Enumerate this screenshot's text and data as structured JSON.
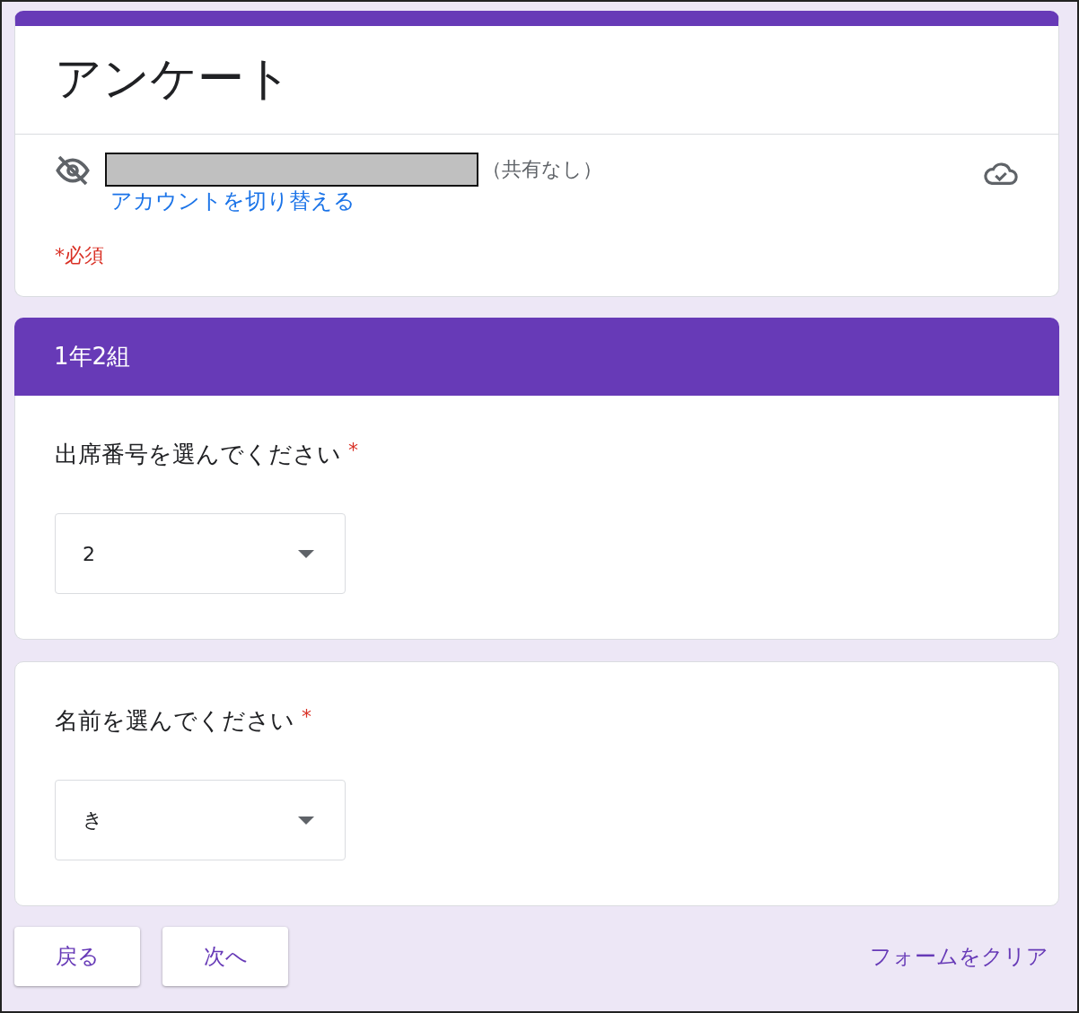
{
  "form": {
    "title": "アンケート",
    "account": {
      "sharing": "（共有なし）",
      "switch_link": "アカウントを切り替える"
    },
    "required_note": "*必須"
  },
  "section": {
    "title": "1年2組"
  },
  "questions": [
    {
      "label": "出席番号を選んでください",
      "required_mark": "*",
      "value": "2"
    },
    {
      "label": "名前を選んでください",
      "required_mark": "*",
      "value": "き"
    }
  ],
  "buttons": [
    "戻る",
    "次へ"
  ],
  "clear_link": "フォームをクリア"
}
